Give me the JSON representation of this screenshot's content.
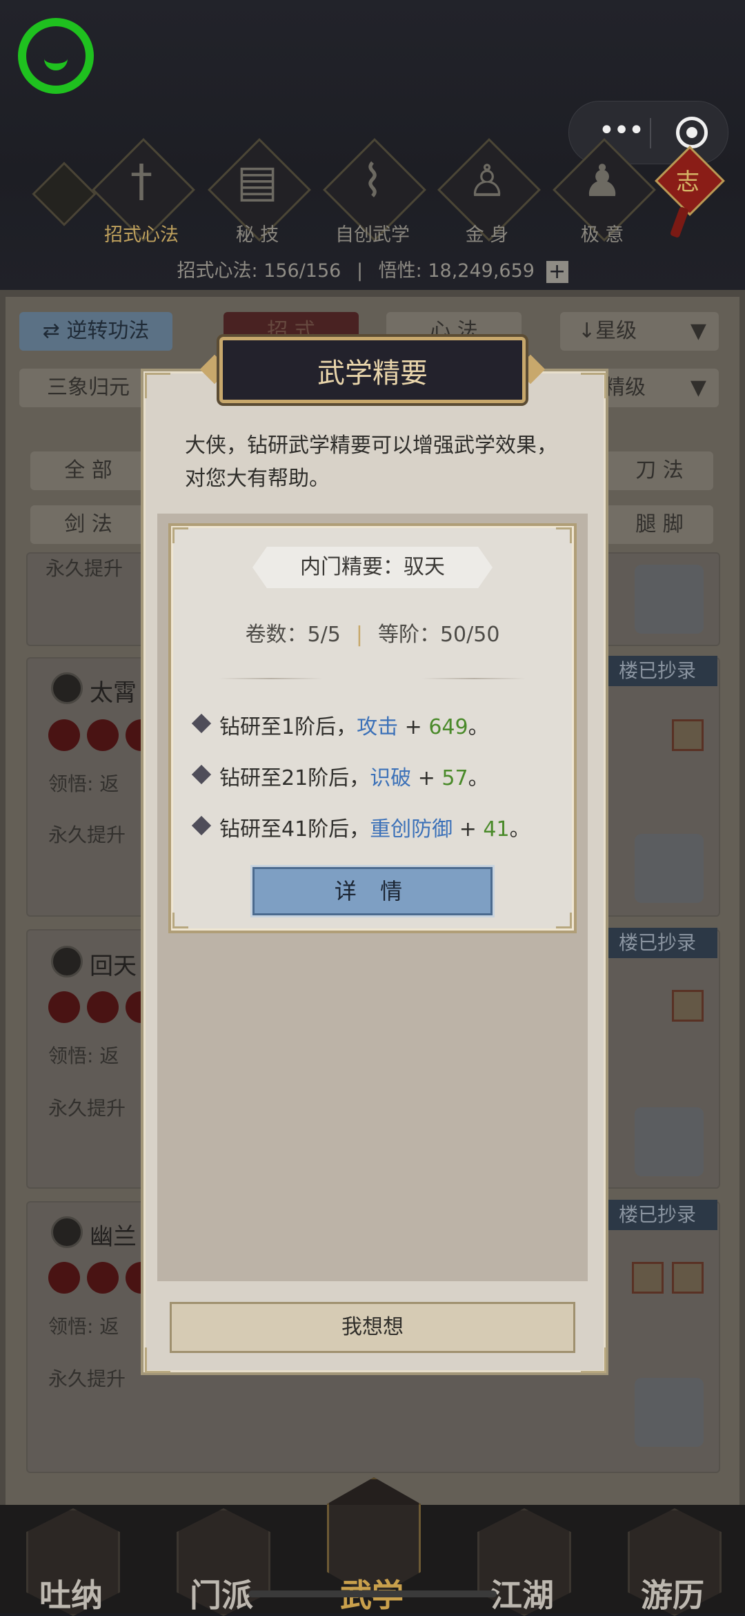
{
  "header": {
    "nav_tabs": [
      {
        "label": "招式心法",
        "icon": "sword-icon",
        "active": true
      },
      {
        "label": "秘 技",
        "icon": "book-icon",
        "active": false
      },
      {
        "label": "自创武学",
        "icon": "scroll-icon",
        "active": false
      },
      {
        "label": "金 身",
        "icon": "meditation-icon",
        "active": false
      },
      {
        "label": "极 意",
        "icon": "martial-stance-icon",
        "active": false
      }
    ],
    "ribbon_text": "志",
    "stats_label_1": "招式心法:",
    "stats_value_1": "156/156",
    "stats_separator": "|",
    "stats_label_2": "悟性:",
    "stats_value_2": "18,249,659",
    "capsule_more": "•••"
  },
  "background": {
    "reverse_button": "逆转功法",
    "reverse_icon": "swap-icon",
    "tab_moves": "招 式",
    "tab_method": "心 法",
    "sort_star": "星级",
    "sort_icon": "arrow-down-icon",
    "filter_left": "三象归元",
    "filter_right": "精级",
    "cat_all": "全 部",
    "cat_blade": "刀 法",
    "cat_sword": "剑 法",
    "cat_leg": "腿 脚",
    "card_top_text": "永久提升",
    "cards": [
      {
        "title": "太霄",
        "comprehend": "领悟: 返",
        "desc": "永久提升",
        "tag": "楼已抄录"
      },
      {
        "title": "回天",
        "comprehend": "领悟: 返",
        "desc": "永久提升",
        "tag": "楼已抄录"
      },
      {
        "title": "幽兰",
        "comprehend": "领悟: 返",
        "desc": "永久提升",
        "tag": "楼已抄录"
      }
    ]
  },
  "modal": {
    "title": "武学精要",
    "intro": "大侠，钻研武学精要可以增强武学效果，对您大有帮助。",
    "section_label": "内门精要：驭天",
    "volumes_label": "卷数：5/5",
    "separator": "|",
    "rank_label": "等阶：50/50",
    "effects": [
      {
        "prefix": "钻研至1阶后，",
        "keyword": "攻击",
        "op": " + ",
        "value": "649",
        "suffix": "。"
      },
      {
        "prefix": "钻研至21阶后，",
        "keyword": "识破",
        "op": " + ",
        "value": "57",
        "suffix": "。"
      },
      {
        "prefix": "钻研至41阶后，",
        "keyword": "重创防御",
        "op": " + ",
        "value": "41",
        "suffix": "。"
      }
    ],
    "detail_button": "详 情",
    "think_button": "我想想"
  },
  "bottom_tabs": [
    {
      "label": "吐纳",
      "active": false
    },
    {
      "label": "门派",
      "active": false
    },
    {
      "label": "武学",
      "active": true
    },
    {
      "label": "江湖",
      "active": false
    },
    {
      "label": "游历",
      "active": false
    }
  ],
  "colors": {
    "accent_gold": "#c8a86c",
    "keyword_blue": "#3c71b8",
    "value_green": "#4a8a2a",
    "wechat_green": "#1fc11f"
  }
}
